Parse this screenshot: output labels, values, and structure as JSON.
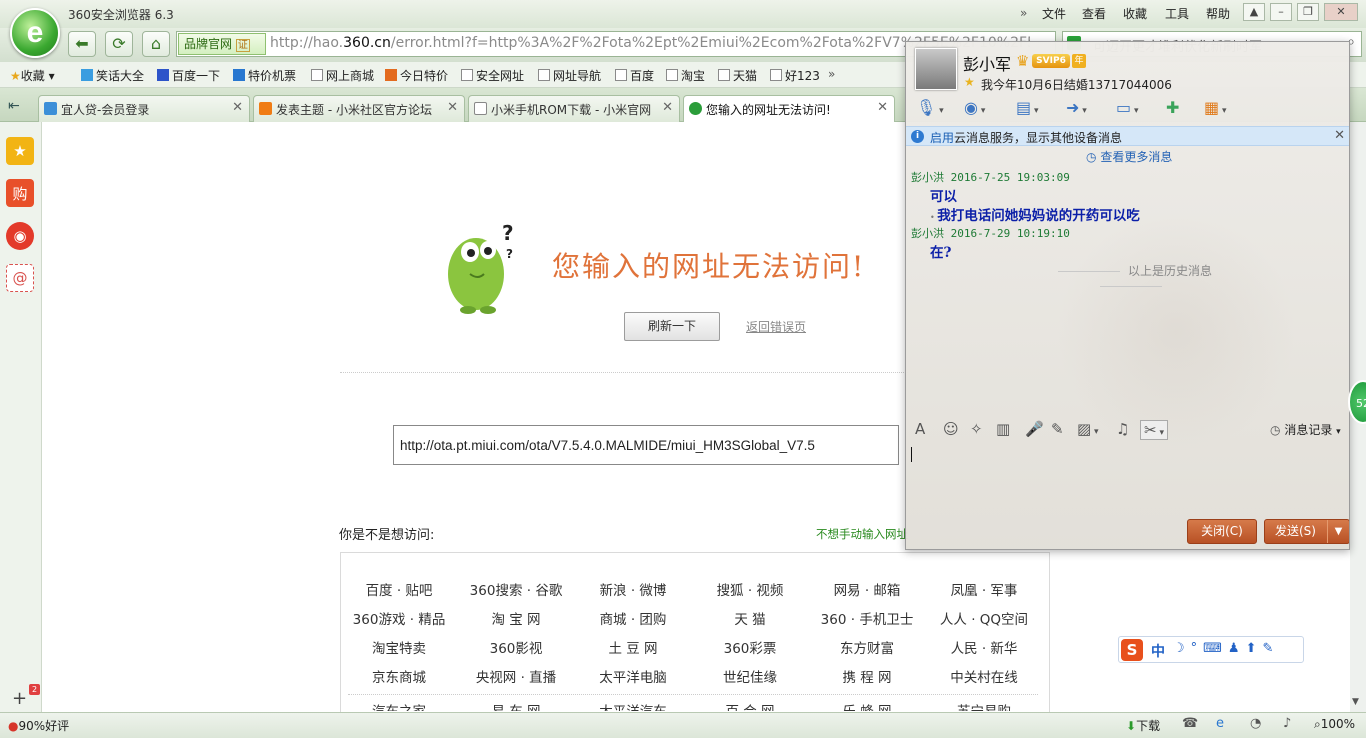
{
  "browser": {
    "title": "360安全浏览器 6.3",
    "menus": [
      "文件",
      "查看",
      "收藏",
      "工具",
      "帮助"
    ],
    "brand_label": "品牌官网",
    "brand_badge": "证",
    "url_prefix": "http://hao.",
    "url_domain": "360.cn",
    "url_rest": "/error.html?f=http%3A%2F%2Fota%2Ept%2Emiui%2Ecom%2Fota%2FV7%2F5E%2F10%2F5E%",
    "search_placeholder": "可迈开更才堆利伏化新刷时军",
    "bookmarks": [
      "收藏",
      "笑话大全",
      "百度一下",
      "特价机票",
      "网上商城",
      "今日特价",
      "安全网址",
      "网址导航",
      "百度",
      "淘宝",
      "天猫",
      "好123"
    ],
    "tabs": [
      {
        "label": "宜人贷-会员登录",
        "active": false
      },
      {
        "label": "发表主题 - 小米社区官方论坛",
        "active": false
      },
      {
        "label": "小米手机ROM下载 - 小米官网",
        "active": false
      },
      {
        "label": "您输入的网址无法访问!",
        "active": true
      }
    ],
    "sidebar_badge": "2",
    "status_left": "90%好评",
    "status_download": "下载",
    "status_zoom": "100%"
  },
  "page": {
    "error_title": "您输入的网址无法访问!",
    "refresh_button": "刷新一下",
    "back_link": "返回错误页",
    "failed_url": "http://ota.pt.miui.com/ota/V7.5.4.0.MALMIDE/miui_HM3SGlobal_V7.5",
    "suggest_label": "你是不是想访问:",
    "manual_hint": "不想手动输入网址",
    "links": [
      [
        "百度 · 贴吧",
        "360搜索 · 谷歌",
        "新浪 · 微博",
        "搜狐 · 视频",
        "网易 · 邮箱",
        "凤凰 · 军事"
      ],
      [
        "360游戏 · 精品",
        "淘 宝 网",
        "商城 · 团购",
        "天 猫",
        "360 · 手机卫士",
        "人人 · QQ空间"
      ],
      [
        "淘宝特卖",
        "360影视",
        "土 豆 网",
        "360彩票",
        "东方财富",
        "人民 · 新华"
      ],
      [
        "京东商城",
        "央视网 · 直播",
        "太平洋电脑",
        "世纪佳缘",
        "携 程 网",
        "中关村在线"
      ],
      [
        "汽车之家",
        "易 车 网",
        "太平洋汽车",
        "百 合 网",
        "乐 蜂 网",
        "苏宁易购"
      ]
    ]
  },
  "qq": {
    "contact_name": "彭小军",
    "vip_badge": "SVIP6",
    "vip_year": "年",
    "signature": "我今年10月6日结婚13717044006",
    "notice_highlight": "启用",
    "notice_text": "云消息服务，显示其他设备消息",
    "more_messages": "查看更多消息",
    "messages": [
      {
        "sender": "彭小洪",
        "time": "2016-7-25 19:03:09",
        "lines": [
          "可以",
          "我打电话问她妈妈说的开药可以吃"
        ]
      },
      {
        "sender": "彭小洪",
        "time": "2016-7-29 10:19:10",
        "lines": [
          "在?"
        ]
      }
    ],
    "history_divider": "以上是历史消息",
    "message_record": "消息记录",
    "close_button": "关闭(C)",
    "send_button": "发送(S)",
    "float_badge": "52"
  },
  "ime": {
    "label": "中"
  }
}
